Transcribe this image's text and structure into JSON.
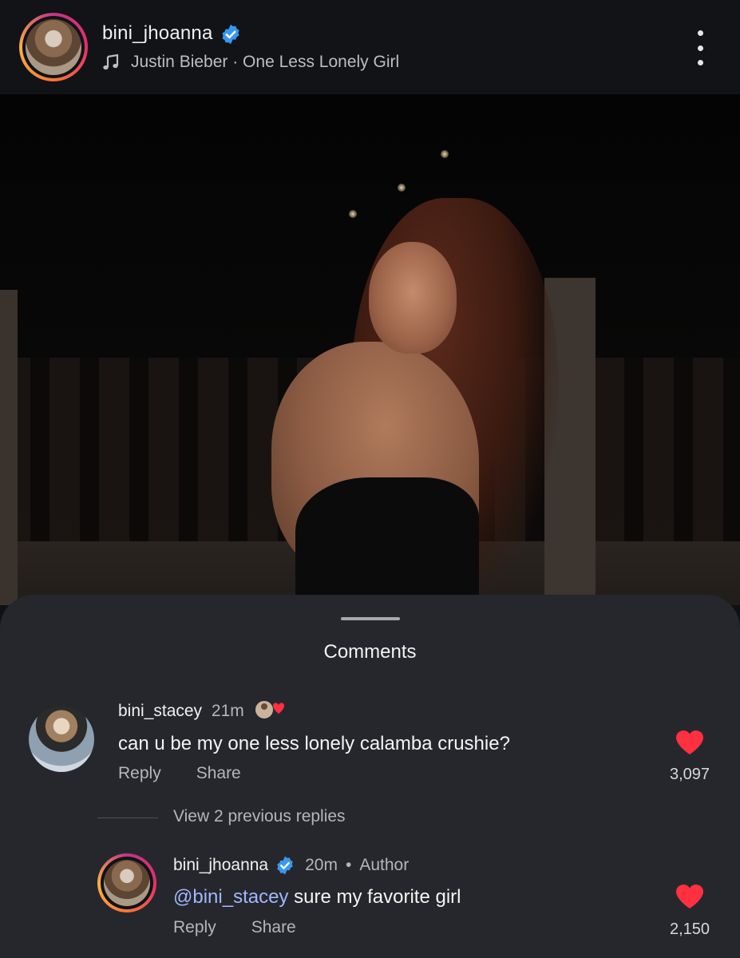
{
  "post": {
    "username": "bini_jhoanna",
    "music": "Justin Bieber · One Less Lonely Girl"
  },
  "comments_sheet": {
    "title": "Comments",
    "comments": [
      {
        "username": "bini_stacey",
        "time": "21m",
        "text": "can u be my one less lonely calamba crushie?",
        "reply_label": "Reply",
        "share_label": "Share",
        "likes": "3,097"
      }
    ],
    "view_replies": "View 2 previous replies",
    "reply": {
      "username": "bini_jhoanna",
      "time": "20m",
      "separator": "•",
      "badge": "Author",
      "mention": "@bini_stacey",
      "text": " sure my favorite girl",
      "reply_label": "Reply",
      "share_label": "Share",
      "likes": "2,150"
    }
  },
  "colors": {
    "verified": "#3897f0",
    "heart": "#ff3040",
    "mention": "#9fb7ff"
  },
  "icons": [
    "verified-badge-icon",
    "music-note-icon",
    "more-options-icon",
    "volume-icon",
    "heart-icon"
  ]
}
